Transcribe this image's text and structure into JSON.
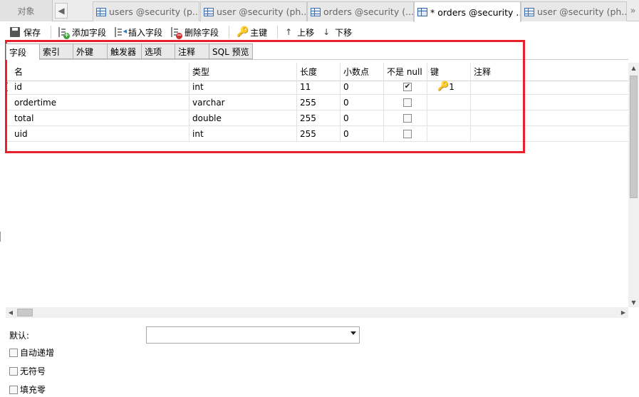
{
  "tabbar": {
    "object_tab": "对象",
    "back_arrow": "◀",
    "more_arrow": "»",
    "tabs": [
      {
        "label": "users @security (p..."
      },
      {
        "label": "user @security (ph..."
      },
      {
        "label": "orders @security (..."
      },
      {
        "label": "* orders @security ..."
      },
      {
        "label": "user @security (ph..."
      }
    ]
  },
  "toolbar": {
    "save": "保存",
    "add_field": "添加字段",
    "insert_field": "插入字段",
    "delete_field": "删除字段",
    "primary_key": "主键",
    "move_up": "上移",
    "move_down": "下移"
  },
  "subtabs": [
    "字段",
    "索引",
    "外键",
    "触发器",
    "选项",
    "注释",
    "SQL 预览"
  ],
  "grid": {
    "headers": {
      "name": "名",
      "type": "类型",
      "length": "长度",
      "decimals": "小数点",
      "not_null": "不是 null",
      "key": "键",
      "comment": "注释"
    },
    "rows": [
      {
        "name": "id",
        "type": "int",
        "length": "11",
        "decimals": "0",
        "not_null": true,
        "key": "1",
        "comment": ""
      },
      {
        "name": "ordertime",
        "type": "varchar",
        "length": "255",
        "decimals": "0",
        "not_null": false,
        "key": "",
        "comment": ""
      },
      {
        "name": "total",
        "type": "double",
        "length": "255",
        "decimals": "0",
        "not_null": false,
        "key": "",
        "comment": ""
      },
      {
        "name": "uid",
        "type": "int",
        "length": "255",
        "decimals": "0",
        "not_null": false,
        "key": "",
        "comment": ""
      }
    ]
  },
  "properties": {
    "default_label": "默认:",
    "default_value": "",
    "auto_increment": "自动递增",
    "unsigned": "无符号",
    "zerofill": "填充零"
  },
  "colors": {
    "highlight": "#e8202a",
    "key_icon": "#d9a400",
    "table_icon": "#3b6db3"
  }
}
